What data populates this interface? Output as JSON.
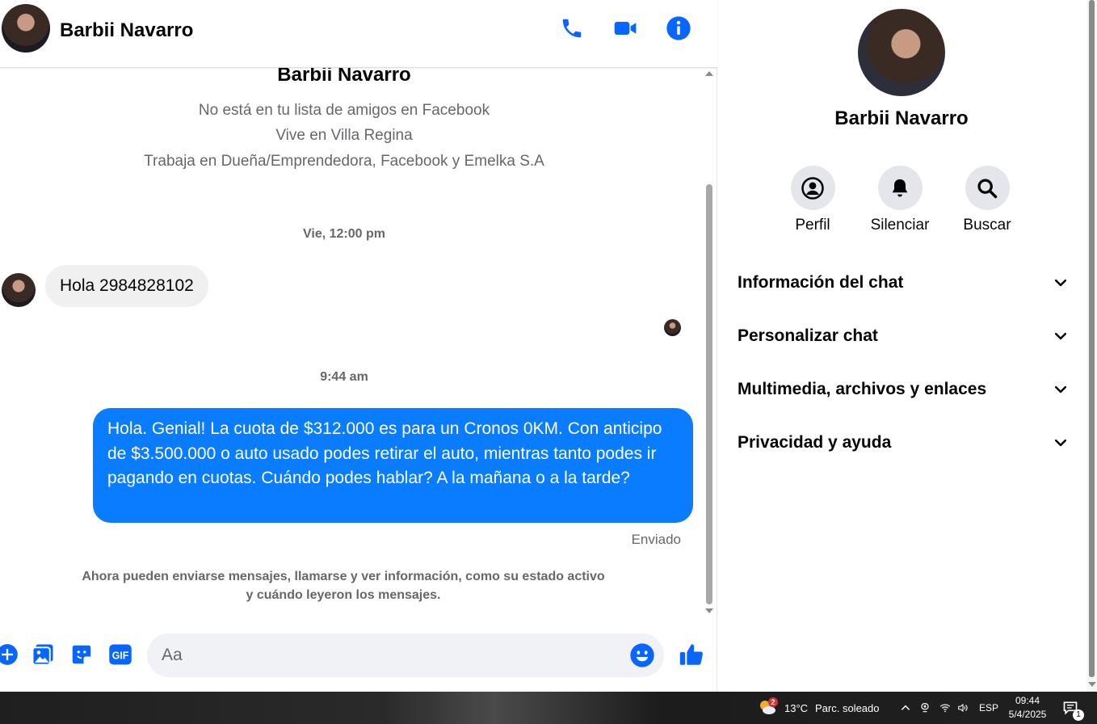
{
  "header": {
    "name": "Barbii Navarro"
  },
  "intro": {
    "name": "Barbii Navarro",
    "lines": [
      "No está en tu lista de amigos en Facebook",
      "Vive en Villa Regina",
      "Trabaja en Dueña/Emprendedora, Facebook y Emelka S.A"
    ]
  },
  "messages": {
    "ts1": "Vie, 12:00 pm",
    "incoming": "Hola 2984828102",
    "ts2": "9:44 am",
    "outgoing": "Hola. Genial! La cuota de $312.000 es para un Cronos 0KM. Con anticipo de $3.500.000 o auto usado podes retirar el auto, mientras tanto podes ir pagando en cuotas. Cuándo podes hablar? A la mañana o a la tarde?",
    "status": "Enviado",
    "notice": "Ahora pueden enviarse mensajes, llamarse y ver información, como su estado activo y cuándo leyeron los mensajes."
  },
  "composer": {
    "placeholder": "Aa",
    "gif_label": "GIF"
  },
  "side": {
    "name": "Barbii Navarro",
    "actions": [
      {
        "label": "Perfil",
        "icon": "profile-icon"
      },
      {
        "label": "Silenciar",
        "icon": "bell-icon"
      },
      {
        "label": "Buscar",
        "icon": "search-icon"
      }
    ],
    "sections": [
      "Información del chat",
      "Personalizar chat",
      "Multimedia, archivos y enlaces",
      "Privacidad y ayuda"
    ]
  },
  "taskbar": {
    "weather_badge": "2",
    "temperature": "13°C",
    "weather_text": "Parc. soleado",
    "language": "ESP",
    "time": "09:44",
    "date": "5/4/2025",
    "notif_count": "1"
  },
  "colors": {
    "accent": "#0a7cff",
    "icon_blue": "#0866ff"
  }
}
